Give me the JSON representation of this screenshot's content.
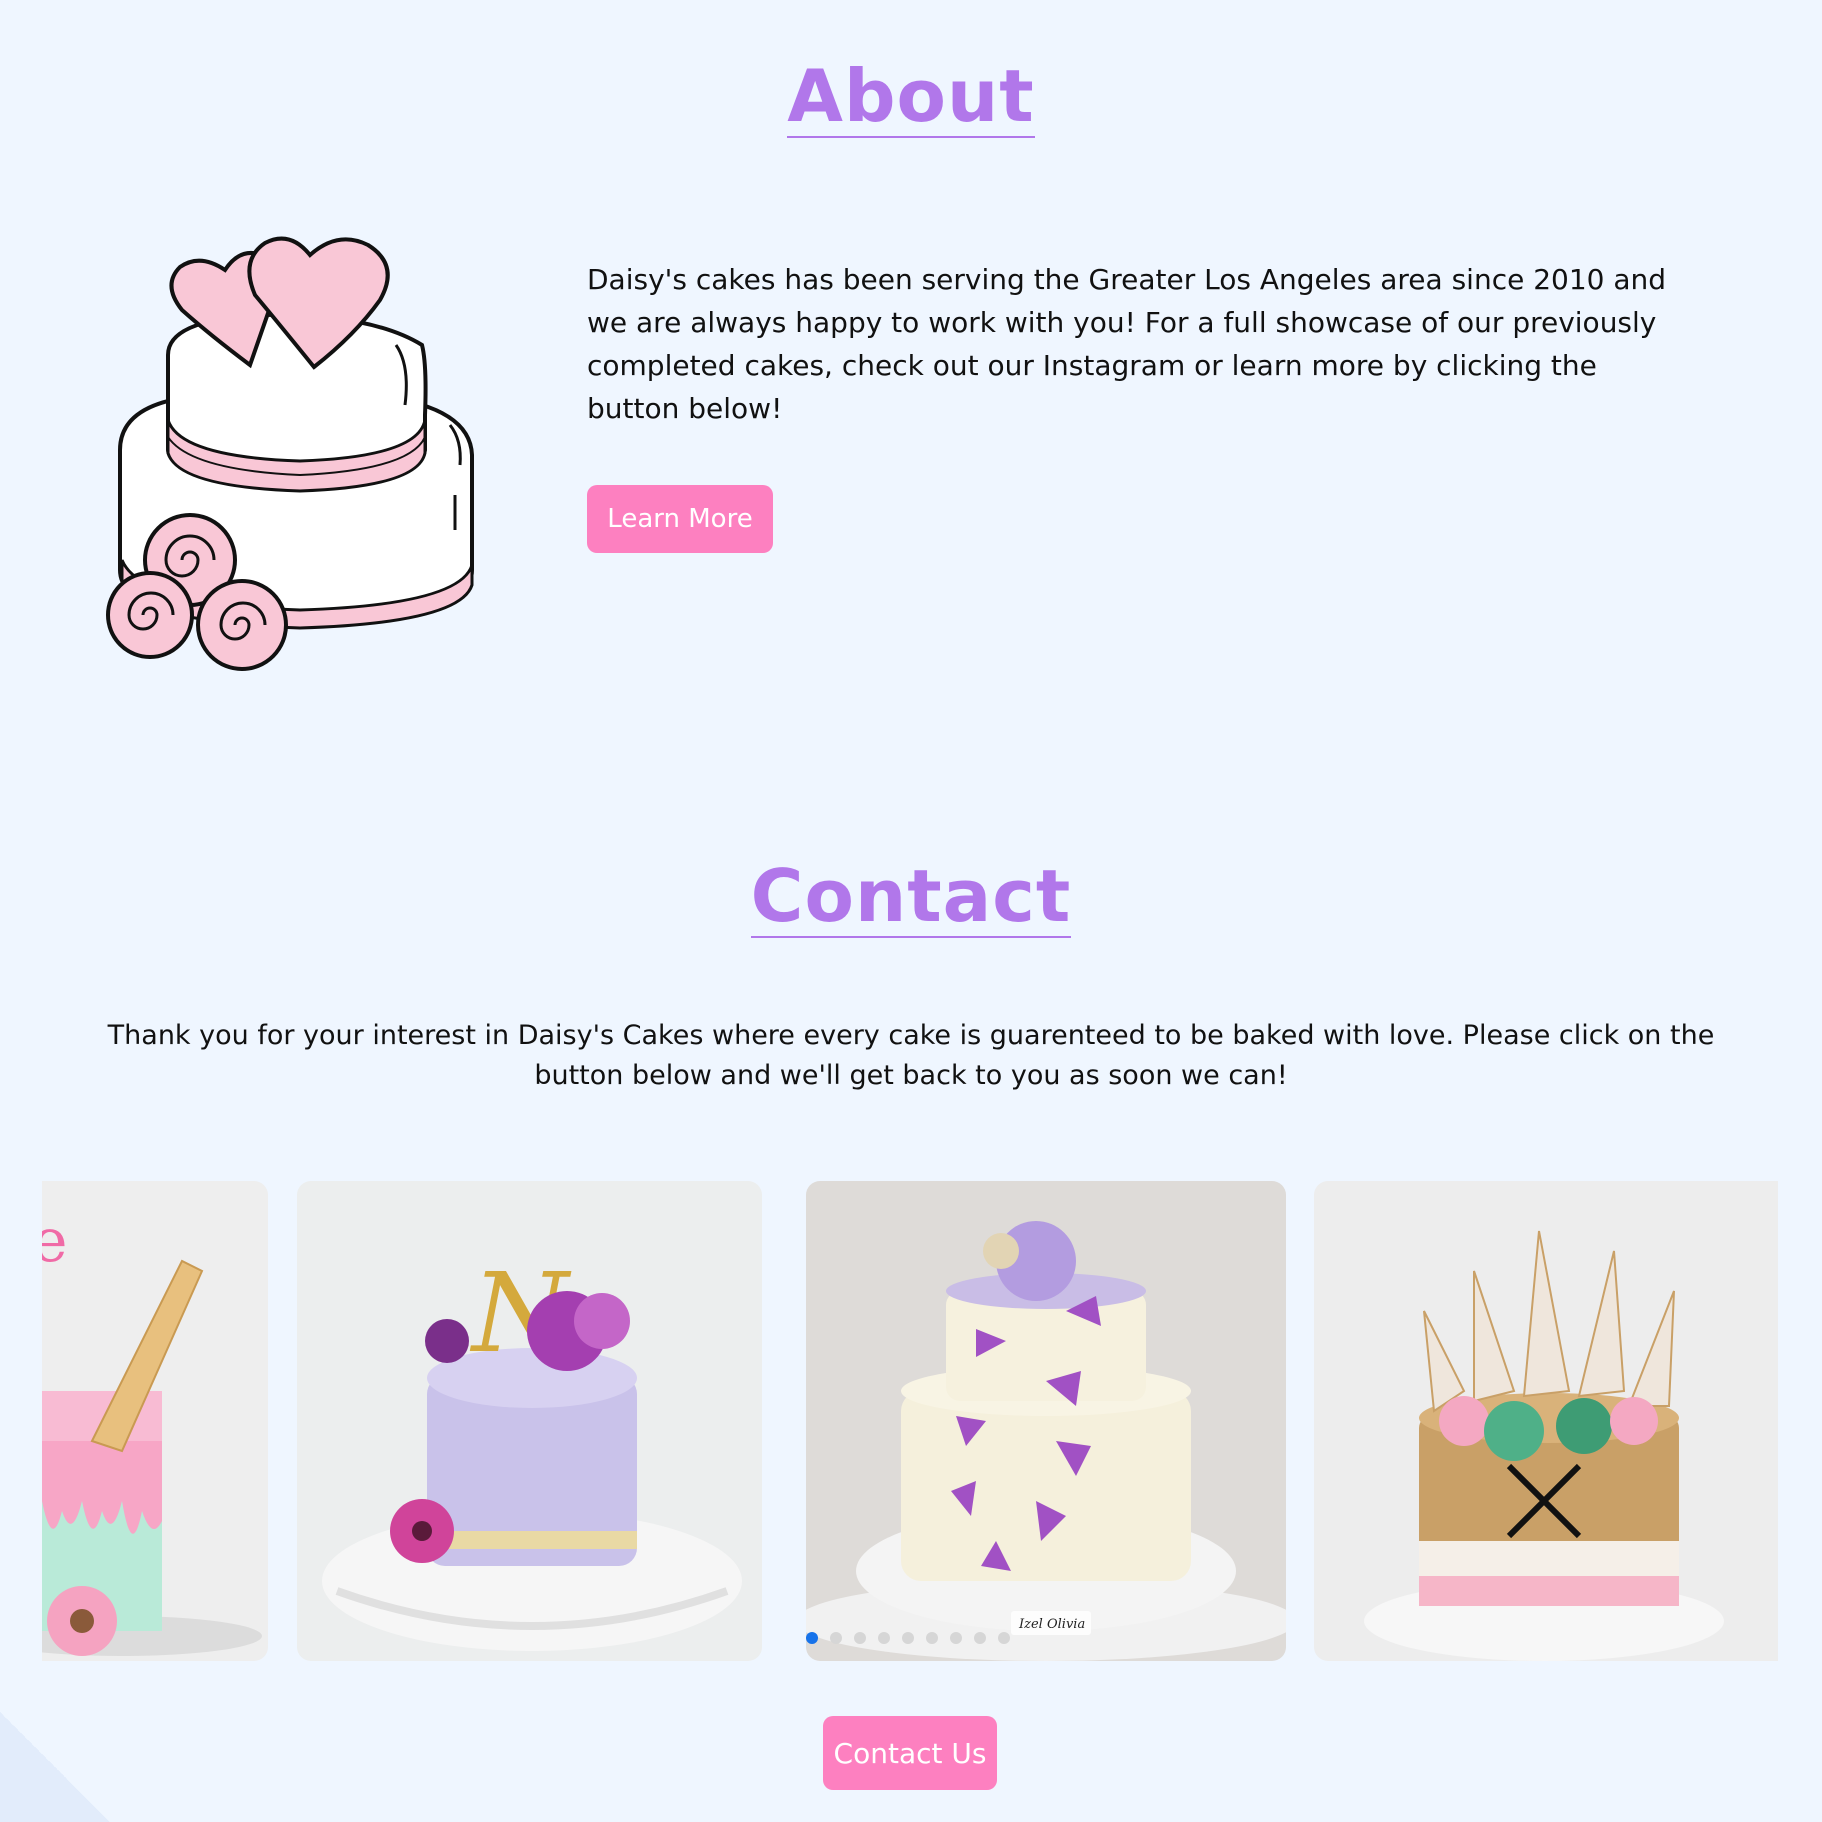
{
  "about": {
    "title": "About",
    "text": "Daisy's cakes has been serving the Greater Los Angeles area since 2010 and we are always happy to work with you! For a full showcase of our previously completed cakes, check out our Instagram or learn more by clicking the button below!",
    "button_label": "Learn More"
  },
  "contact": {
    "title": "Contact",
    "text": "Thank you for your interest in Daisy's Cakes where every cake is guarenteed to be baked with love. Please click on the button below and we'll get back to you as soon we can!",
    "button_label": "Contact Us"
  },
  "carousel": {
    "slides": [
      "donut-ice-cream-cake",
      "lavender-monogram-cake",
      "purple-butterfly-tiered-cake",
      "gold-feather-arrow-cake"
    ],
    "cake_topper_letter": "N",
    "cake_plaque_text": "Izel Olivia",
    "dot_count": 9,
    "active_dot_index": 0
  },
  "colors": {
    "background": "#eff6ff",
    "heading": "#b177ea",
    "button": "#fd80c0",
    "active_dot": "#1773ea"
  }
}
